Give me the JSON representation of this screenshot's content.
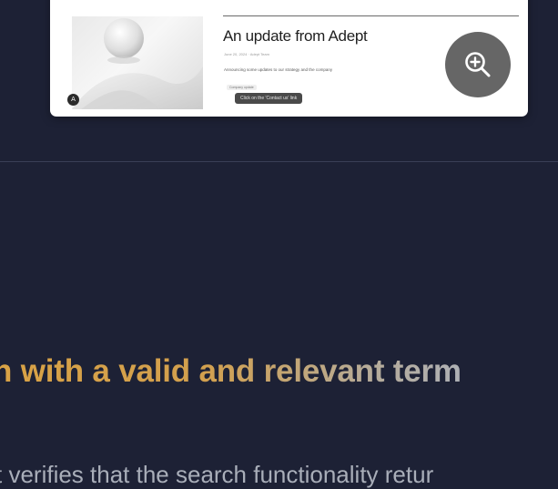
{
  "card": {
    "title": "An update from Adept",
    "meta": "June 20, 2024  ·  Adept Team",
    "description": "Announcing some updates to our strategy and the company",
    "tag": "Company update",
    "tooltip": "Click on the 'Contact us' link",
    "badge": "A",
    "zoom_icon": "zoom-in-icon"
  },
  "section": {
    "heading": "h with a valid and relevant term",
    "body": "t verifies that the search functionality retur"
  },
  "colors": {
    "background": "#1d2135",
    "card_bg": "#ffffff",
    "zoom_button": "#666666",
    "heading_gold": "#d9a245",
    "body_text": "#a9aeb9"
  }
}
